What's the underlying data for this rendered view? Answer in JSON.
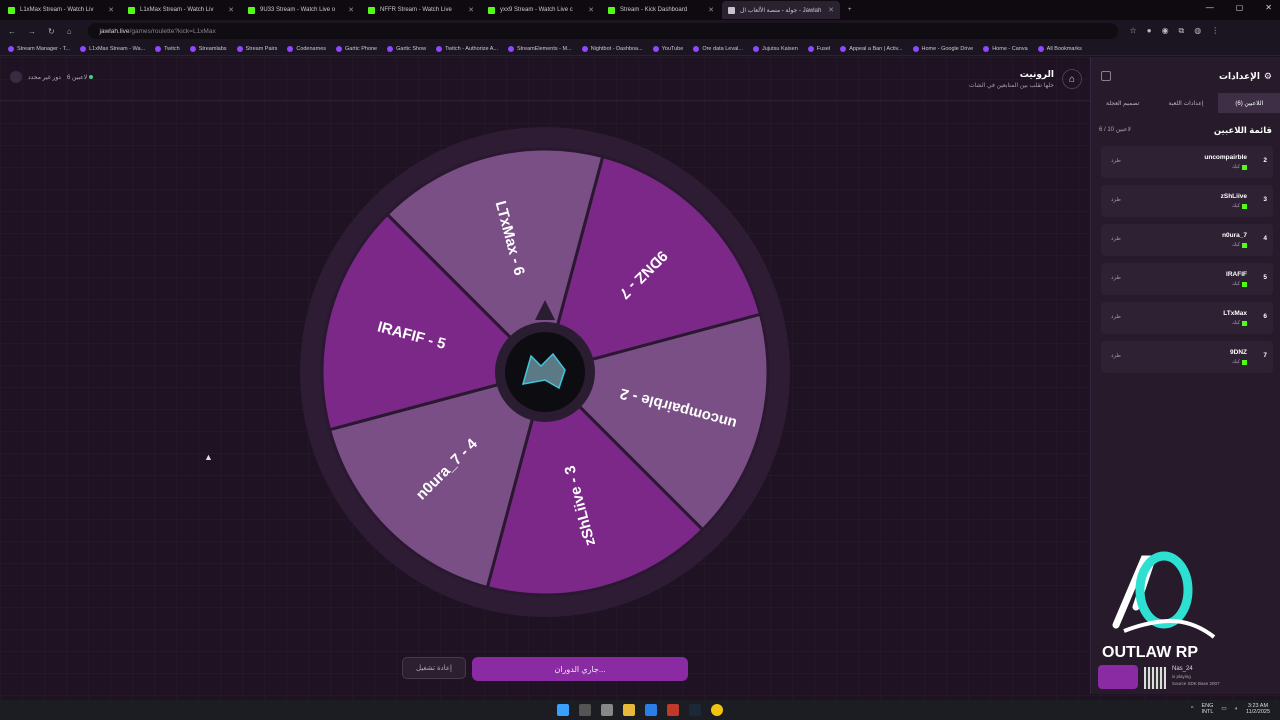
{
  "browser": {
    "tabs": [
      {
        "label": "L1xMax Stream - Watch Liv"
      },
      {
        "label": "L1xMax Stream - Watch Liv"
      },
      {
        "label": "9U33 Stream - Watch Live o"
      },
      {
        "label": "NFFR Stream - Watch Live"
      },
      {
        "label": "yxx9 Stream - Watch Live c"
      },
      {
        "label": "Stream - Kick Dashboard"
      },
      {
        "label": "جولة - منصة الألعاب ال - Jawlah"
      }
    ],
    "url_host": "jawlah.live",
    "url_path": "/games/roulette?kick=L1xMax",
    "bookmarks": [
      "Stream Manager - T...",
      "L1xMax Stream - Wa...",
      "Twitch",
      "Streamlabs",
      "Stream Pairs",
      "Codenames",
      "Gartic Phone",
      "Gartic Show",
      "Twitch - Authorize A...",
      "StreamElements - M...",
      "Nightbot - Dashboa...",
      "YouTube",
      "Ore data Leval...",
      "Jujutsu Kaisen",
      "Fusel",
      "Appeal a Ban | Activ...",
      "Home - Google Drive",
      "Home - Canva",
      "All Bookmarks"
    ]
  },
  "header": {
    "title": "الرونيت",
    "subtitle": "خلها تقلب بين المتابعين في الشات",
    "players_chip": "6 لاعبين",
    "role_chip": "دور غير محدد"
  },
  "wheel": {
    "center_logo": "wolf-emblem",
    "segments": [
      {
        "label": "9DNZ - 7",
        "color": "#7b2888"
      },
      {
        "label": "uncompairble - 2",
        "color": "#7a4f86"
      },
      {
        "label": "zShLiive - 3",
        "color": "#7b2888"
      },
      {
        "label": "n0ura_7 - 4",
        "color": "#7a4f86"
      },
      {
        "label": "IRAFIF - 5",
        "color": "#7b2888"
      },
      {
        "label": "LTxMax - 6",
        "color": "#7a4f86"
      }
    ]
  },
  "controls": {
    "spin_label": "جاري الدوران...",
    "reset_label": "إعادة تشغيل"
  },
  "panel": {
    "title": "الإعدادات",
    "tabs": [
      "اللاعبين (6)",
      "إعدادات اللعبة",
      "تصميم العجلة"
    ],
    "list_title": "قائمة اللاعبين",
    "list_count": "6 / 10 لاعبين",
    "kick_label": "طرد",
    "players": [
      {
        "num": "2",
        "name": "uncompairble",
        "tag": "كيك"
      },
      {
        "num": "3",
        "name": "zShLiive",
        "tag": "كيك"
      },
      {
        "num": "4",
        "name": "n0ura_7",
        "tag": "كيك"
      },
      {
        "num": "5",
        "name": "IRAFIF",
        "tag": "كيك"
      },
      {
        "num": "6",
        "name": "LTxMax",
        "tag": "كيك"
      },
      {
        "num": "7",
        "name": "9DNZ",
        "tag": "كيك"
      }
    ]
  },
  "overlay": {
    "brand": "OUTLAW RP",
    "viewer": "Nas_24",
    "viewer_status": "is playing",
    "viewer_source": "Source SDK Base 2007"
  },
  "taskbar": {
    "lang": "ENG",
    "lang2": "INTL",
    "time": "3:23 AM",
    "date": "11/2/2025"
  },
  "colors": {
    "accent": "#8b2ba3",
    "background": "#1e1223",
    "panel": "#261a2b",
    "kick_green": "#53fc18"
  }
}
